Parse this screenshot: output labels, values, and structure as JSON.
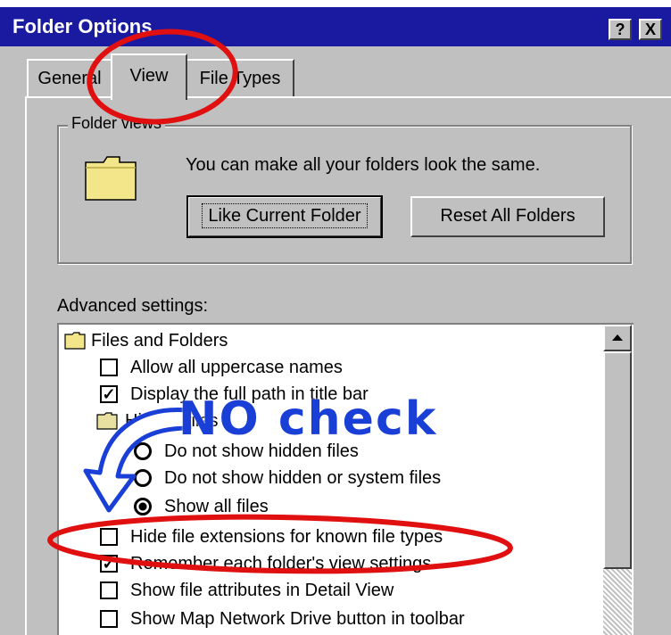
{
  "window": {
    "title": "Folder Options",
    "help_btn": "?",
    "close_btn": "X"
  },
  "tabs": [
    {
      "label": "General"
    },
    {
      "label": "View",
      "active": true
    },
    {
      "label": "File Types"
    }
  ],
  "folder_views": {
    "legend": "Folder views",
    "description": "You can make all your folders look the same.",
    "like_current_btn": "Like Current Folder",
    "reset_all_btn": "Reset All Folders"
  },
  "advanced": {
    "label": "Advanced settings:",
    "items": [
      {
        "type": "folder",
        "label": "Files and Folders",
        "indent": 0
      },
      {
        "type": "checkbox",
        "label": "Allow all uppercase names",
        "checked": false,
        "indent": 1
      },
      {
        "type": "checkbox",
        "label": "Display the full path in title bar",
        "checked": true,
        "indent": 1
      },
      {
        "type": "folder",
        "label": "Hidden files",
        "indent": 1
      },
      {
        "type": "radio",
        "label": "Do not show hidden files",
        "selected": false,
        "indent": 2
      },
      {
        "type": "radio",
        "label": "Do not show hidden or system files",
        "selected": false,
        "indent": 2
      },
      {
        "type": "radio",
        "label": "Show all files",
        "selected": true,
        "indent": 2
      },
      {
        "type": "checkbox",
        "label": "Hide file extensions for known file types",
        "checked": false,
        "indent": 1
      },
      {
        "type": "checkbox",
        "label": "Remember each folder's view settings",
        "checked": true,
        "indent": 1
      },
      {
        "type": "checkbox",
        "label": "Show file attributes in Detail View",
        "checked": false,
        "indent": 1
      },
      {
        "type": "checkbox",
        "label": "Show Map Network Drive button in toolbar",
        "checked": false,
        "indent": 1
      }
    ]
  },
  "annotation": {
    "text": "NO check",
    "color": "#1a3fd6",
    "circle_color": "#e01010"
  },
  "colors": {
    "titlebar": "#1a1aa0",
    "face": "#c0c0c0"
  }
}
